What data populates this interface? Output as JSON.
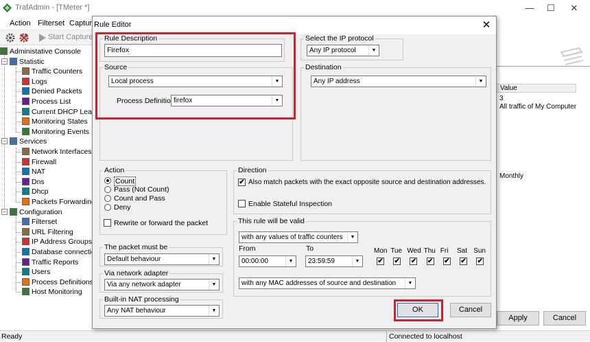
{
  "main_window": {
    "title": "TrafAdmin - [TMeter *]",
    "menu": [
      "Action",
      "Filterset",
      "Capture"
    ],
    "toolbar": {
      "start_capture": "Start Capture"
    },
    "tree": [
      {
        "label": "Administative Console",
        "icon": "console-icon",
        "level": 0
      },
      {
        "label": "Statistic",
        "icon": "statistic-icon",
        "level": 1
      },
      {
        "label": "Traffic Counters",
        "icon": "traffic-counters-icon",
        "level": 2
      },
      {
        "label": "Logs",
        "icon": "logs-icon",
        "level": 2
      },
      {
        "label": "Denied Packets",
        "icon": "denied-packets-icon",
        "level": 2
      },
      {
        "label": "Process List",
        "icon": "process-list-icon",
        "level": 2
      },
      {
        "label": "Current DHCP Lease",
        "icon": "dhcp-lease-icon",
        "level": 2
      },
      {
        "label": "Monitoring States",
        "icon": "monitoring-states-icon",
        "level": 2
      },
      {
        "label": "Monitoring Events",
        "icon": "monitoring-events-icon",
        "level": 2
      },
      {
        "label": "Services",
        "icon": "services-icon",
        "level": 1
      },
      {
        "label": "Network Interfaces",
        "icon": "network-interfaces-icon",
        "level": 2
      },
      {
        "label": "Firewall",
        "icon": "firewall-icon",
        "level": 2
      },
      {
        "label": "NAT",
        "icon": "nat-icon",
        "level": 2
      },
      {
        "label": "Dns",
        "icon": "dns-icon",
        "level": 2
      },
      {
        "label": "Dhcp",
        "icon": "dhcp-icon",
        "level": 2
      },
      {
        "label": "Packets Forwarding",
        "icon": "packets-forwarding-icon",
        "level": 2
      },
      {
        "label": "Configuration",
        "icon": "configuration-icon",
        "level": 1
      },
      {
        "label": "Filterset",
        "icon": "filterset-icon",
        "level": 2
      },
      {
        "label": "URL Filtering",
        "icon": "url-filtering-icon",
        "level": 2
      },
      {
        "label": "IP Address Groups",
        "icon": "ip-groups-icon",
        "level": 2
      },
      {
        "label": "Database connection",
        "icon": "database-icon",
        "level": 2
      },
      {
        "label": "Traffic Reports",
        "icon": "traffic-reports-icon",
        "level": 2
      },
      {
        "label": "Users",
        "icon": "users-icon",
        "level": 2
      },
      {
        "label": "Process Definitions",
        "icon": "process-definitions-icon",
        "level": 2
      },
      {
        "label": "Host Monitoring",
        "icon": "host-monitoring-icon",
        "level": 2
      }
    ],
    "right_pane": {
      "column_header": "Value",
      "values": [
        "3",
        "All traffic of My Computer"
      ],
      "value_monthly": "Monthly",
      "apply_label": "Apply",
      "cancel_label": "Cancel"
    },
    "status_left": "Ready",
    "status_right": "Connected to localhost"
  },
  "dialog": {
    "title": "Rule Editor",
    "rule_description": {
      "legend": "Rule Description",
      "value": "Firefox"
    },
    "ip_protocol": {
      "legend": "Select the IP protocol",
      "value": "Any IP protocol"
    },
    "source": {
      "legend": "Source",
      "value": "Local process",
      "process_definition_label": "Process Definition :",
      "process_definition_value": "firefox"
    },
    "destination": {
      "legend": "Destination",
      "value": "Any IP address"
    },
    "action": {
      "legend": "Action",
      "options": [
        "Count",
        "Pass (Not Count)",
        "Count and Pass",
        "Deny"
      ],
      "selected": 0,
      "rewrite_label": "Rewrite or forward the packet",
      "rewrite_checked": false
    },
    "direction": {
      "legend": "Direction",
      "opposite_label": "Also match packets with the exact opposite source and destination addresses.",
      "opposite_checked": true,
      "stateful_label": "Enable Stateful Inspection",
      "stateful_checked": false
    },
    "packet_must_be": {
      "legend": "The packet must be",
      "value": "Default behaviour"
    },
    "via_adapter": {
      "legend": "Via network adapter",
      "value": "Via any network adapter"
    },
    "nat_processing": {
      "legend": "Built-in NAT processing",
      "value": "Any NAT behaviour"
    },
    "validity": {
      "legend": "This rule will be valid",
      "counter_condition": "with any values of traffic counters",
      "from_label": "From",
      "to_label": "To",
      "from_value": "00:00:00",
      "to_value": "23:59:59",
      "days": [
        "Mon",
        "Tue",
        "Wed",
        "Thu",
        "Fri",
        "Sat",
        "Sun"
      ],
      "days_checked": [
        true,
        true,
        true,
        true,
        true,
        true,
        true
      ],
      "mac_condition": "with any MAC addresses of source and destination"
    },
    "ok_label": "OK",
    "cancel_label": "Cancel",
    "highlight_color": "#d2232a"
  }
}
